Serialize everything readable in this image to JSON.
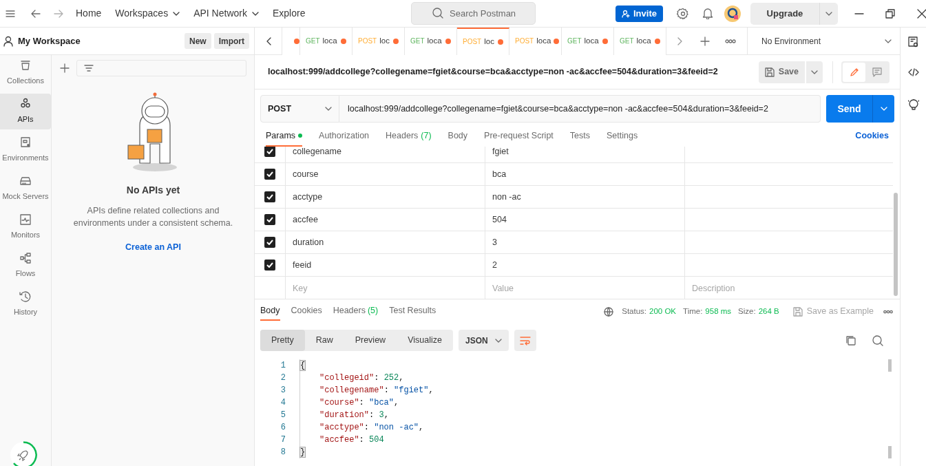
{
  "top_nav": [
    {
      "label": "Home",
      "dropdown": false
    },
    {
      "label": "Workspaces",
      "dropdown": true
    },
    {
      "label": "API Network",
      "dropdown": true
    },
    {
      "label": "Explore",
      "dropdown": false
    }
  ],
  "search": {
    "placeholder": "Search Postman"
  },
  "invite_button": "Invite",
  "upgrade_button": "Upgrade",
  "workspace": {
    "name": "My Workspace",
    "buttons": [
      "New",
      "Import"
    ]
  },
  "sidebar": {
    "items": [
      {
        "label": "Collections",
        "selected": false
      },
      {
        "label": "APIs",
        "selected": true
      },
      {
        "label": "Environments",
        "selected": false
      },
      {
        "label": "Mock Servers",
        "selected": false
      },
      {
        "label": "Monitors",
        "selected": false
      },
      {
        "label": "Flows",
        "selected": false
      },
      {
        "label": "History",
        "selected": false
      }
    ]
  },
  "apis_panel": {
    "title": "No APIs yet",
    "description": "APIs define related collections and environments under a consistent schema.",
    "link": "Create an API"
  },
  "open_tabs": [
    {
      "unsaved": true,
      "selected": false
    },
    {
      "method": "GET",
      "name": "loca",
      "unsaved": true,
      "selected": false
    },
    {
      "method": "POST",
      "name": "loc",
      "unsaved": true,
      "selected": false
    },
    {
      "method": "GET",
      "name": "loca",
      "unsaved": true,
      "selected": false
    },
    {
      "method": "POST",
      "name": "loc",
      "unsaved": true,
      "selected": true
    },
    {
      "method": "POST",
      "name": "loca",
      "unsaved": true,
      "selected": false
    },
    {
      "method": "GET",
      "name": "loca",
      "unsaved": true,
      "selected": false
    },
    {
      "method": "GET",
      "name": "loca",
      "unsaved": true,
      "selected": false
    }
  ],
  "environment": "No Environment",
  "view_toggle": [
    {
      "kind": "edit",
      "selected": true
    },
    {
      "kind": "comment",
      "selected": false
    }
  ],
  "request": {
    "name": "localhost:999/addcollege?collegename=fgiet&course=bca&acctype=non -ac&accfee=504&duration=3&feeid=2",
    "method": "POST",
    "url": "localhost:999/addcollege?collegename=fgiet&course=bca&acctype=non -ac&accfee=504&duration=3&feeid=2",
    "send": "Send",
    "save": "Save"
  },
  "request_sections": [
    {
      "label": "Params",
      "indicator": true,
      "selected": true
    },
    {
      "label": "Authorization",
      "selected": false
    },
    {
      "label": "Headers",
      "count": "(7)",
      "selected": false
    },
    {
      "label": "Body",
      "selected": false
    },
    {
      "label": "Pre-request Script",
      "selected": false
    },
    {
      "label": "Tests",
      "selected": false
    },
    {
      "label": "Settings",
      "selected": false
    }
  ],
  "cookies_link": "Cookies",
  "params": {
    "rows": [
      {
        "key": "collegename",
        "value": "fgiet",
        "checked": true
      },
      {
        "key": "course",
        "value": "bca",
        "checked": true
      },
      {
        "key": "acctype",
        "value": "non -ac",
        "checked": true
      },
      {
        "key": "accfee",
        "value": "504",
        "checked": true
      },
      {
        "key": "duration",
        "value": "3",
        "checked": true
      },
      {
        "key": "feeid",
        "value": "2",
        "checked": true
      }
    ],
    "new_row": {
      "key": {
        "placeholder": "Key"
      },
      "value": {
        "placeholder": "Value"
      },
      "description": {
        "placeholder": "Description"
      }
    }
  },
  "response": {
    "tabs": [
      {
        "label": "Body",
        "selected": true
      },
      {
        "label": "Cookies",
        "selected": false
      },
      {
        "label": "Headers",
        "count": "(5)",
        "selected": false
      },
      {
        "label": "Test Results",
        "selected": false
      }
    ],
    "stats": [
      {
        "label": "Status:",
        "value": "200 OK"
      },
      {
        "label": "Time:",
        "value": "958 ms"
      },
      {
        "label": "Size:",
        "value": "264 B"
      }
    ],
    "save_example": "Save as Example",
    "view_modes": [
      {
        "label": "Pretty",
        "selected": true
      },
      {
        "label": "Raw",
        "selected": false
      },
      {
        "label": "Preview",
        "selected": false
      },
      {
        "label": "Visualize",
        "selected": false
      }
    ],
    "format": "JSON",
    "lines": [
      {
        "number": "1",
        "tokens": [
          {
            "text": "{",
            "kind": "brace"
          }
        ]
      },
      {
        "number": "2",
        "tokens": [
          {
            "text": "\"collegeid\"",
            "kind": "key"
          },
          {
            "text": ": ",
            "kind": "punct"
          },
          {
            "text": "252",
            "kind": "number"
          },
          {
            "text": ",",
            "kind": "punct"
          }
        ]
      },
      {
        "number": "3",
        "tokens": [
          {
            "text": "\"collegename\"",
            "kind": "key"
          },
          {
            "text": ": ",
            "kind": "punct"
          },
          {
            "text": "\"fgiet\"",
            "kind": "string"
          },
          {
            "text": ",",
            "kind": "punct"
          }
        ]
      },
      {
        "number": "4",
        "tokens": [
          {
            "text": "\"course\"",
            "kind": "key"
          },
          {
            "text": ": ",
            "kind": "punct"
          },
          {
            "text": "\"bca\"",
            "kind": "string"
          },
          {
            "text": ",",
            "kind": "punct"
          }
        ]
      },
      {
        "number": "5",
        "tokens": [
          {
            "text": "\"duration\"",
            "kind": "key"
          },
          {
            "text": ": ",
            "kind": "punct"
          },
          {
            "text": "3",
            "kind": "number"
          },
          {
            "text": ",",
            "kind": "punct"
          }
        ]
      },
      {
        "number": "6",
        "tokens": [
          {
            "text": "\"acctype\"",
            "kind": "key"
          },
          {
            "text": ": ",
            "kind": "punct"
          },
          {
            "text": "\"non -ac\"",
            "kind": "string"
          },
          {
            "text": ",",
            "kind": "punct"
          }
        ]
      },
      {
        "number": "7",
        "tokens": [
          {
            "text": "\"accfee\"",
            "kind": "key"
          },
          {
            "text": ": ",
            "kind": "punct"
          },
          {
            "text": "504",
            "kind": "number"
          }
        ]
      },
      {
        "number": "8",
        "tokens": [
          {
            "text": "}",
            "kind": "brace"
          }
        ]
      }
    ]
  }
}
